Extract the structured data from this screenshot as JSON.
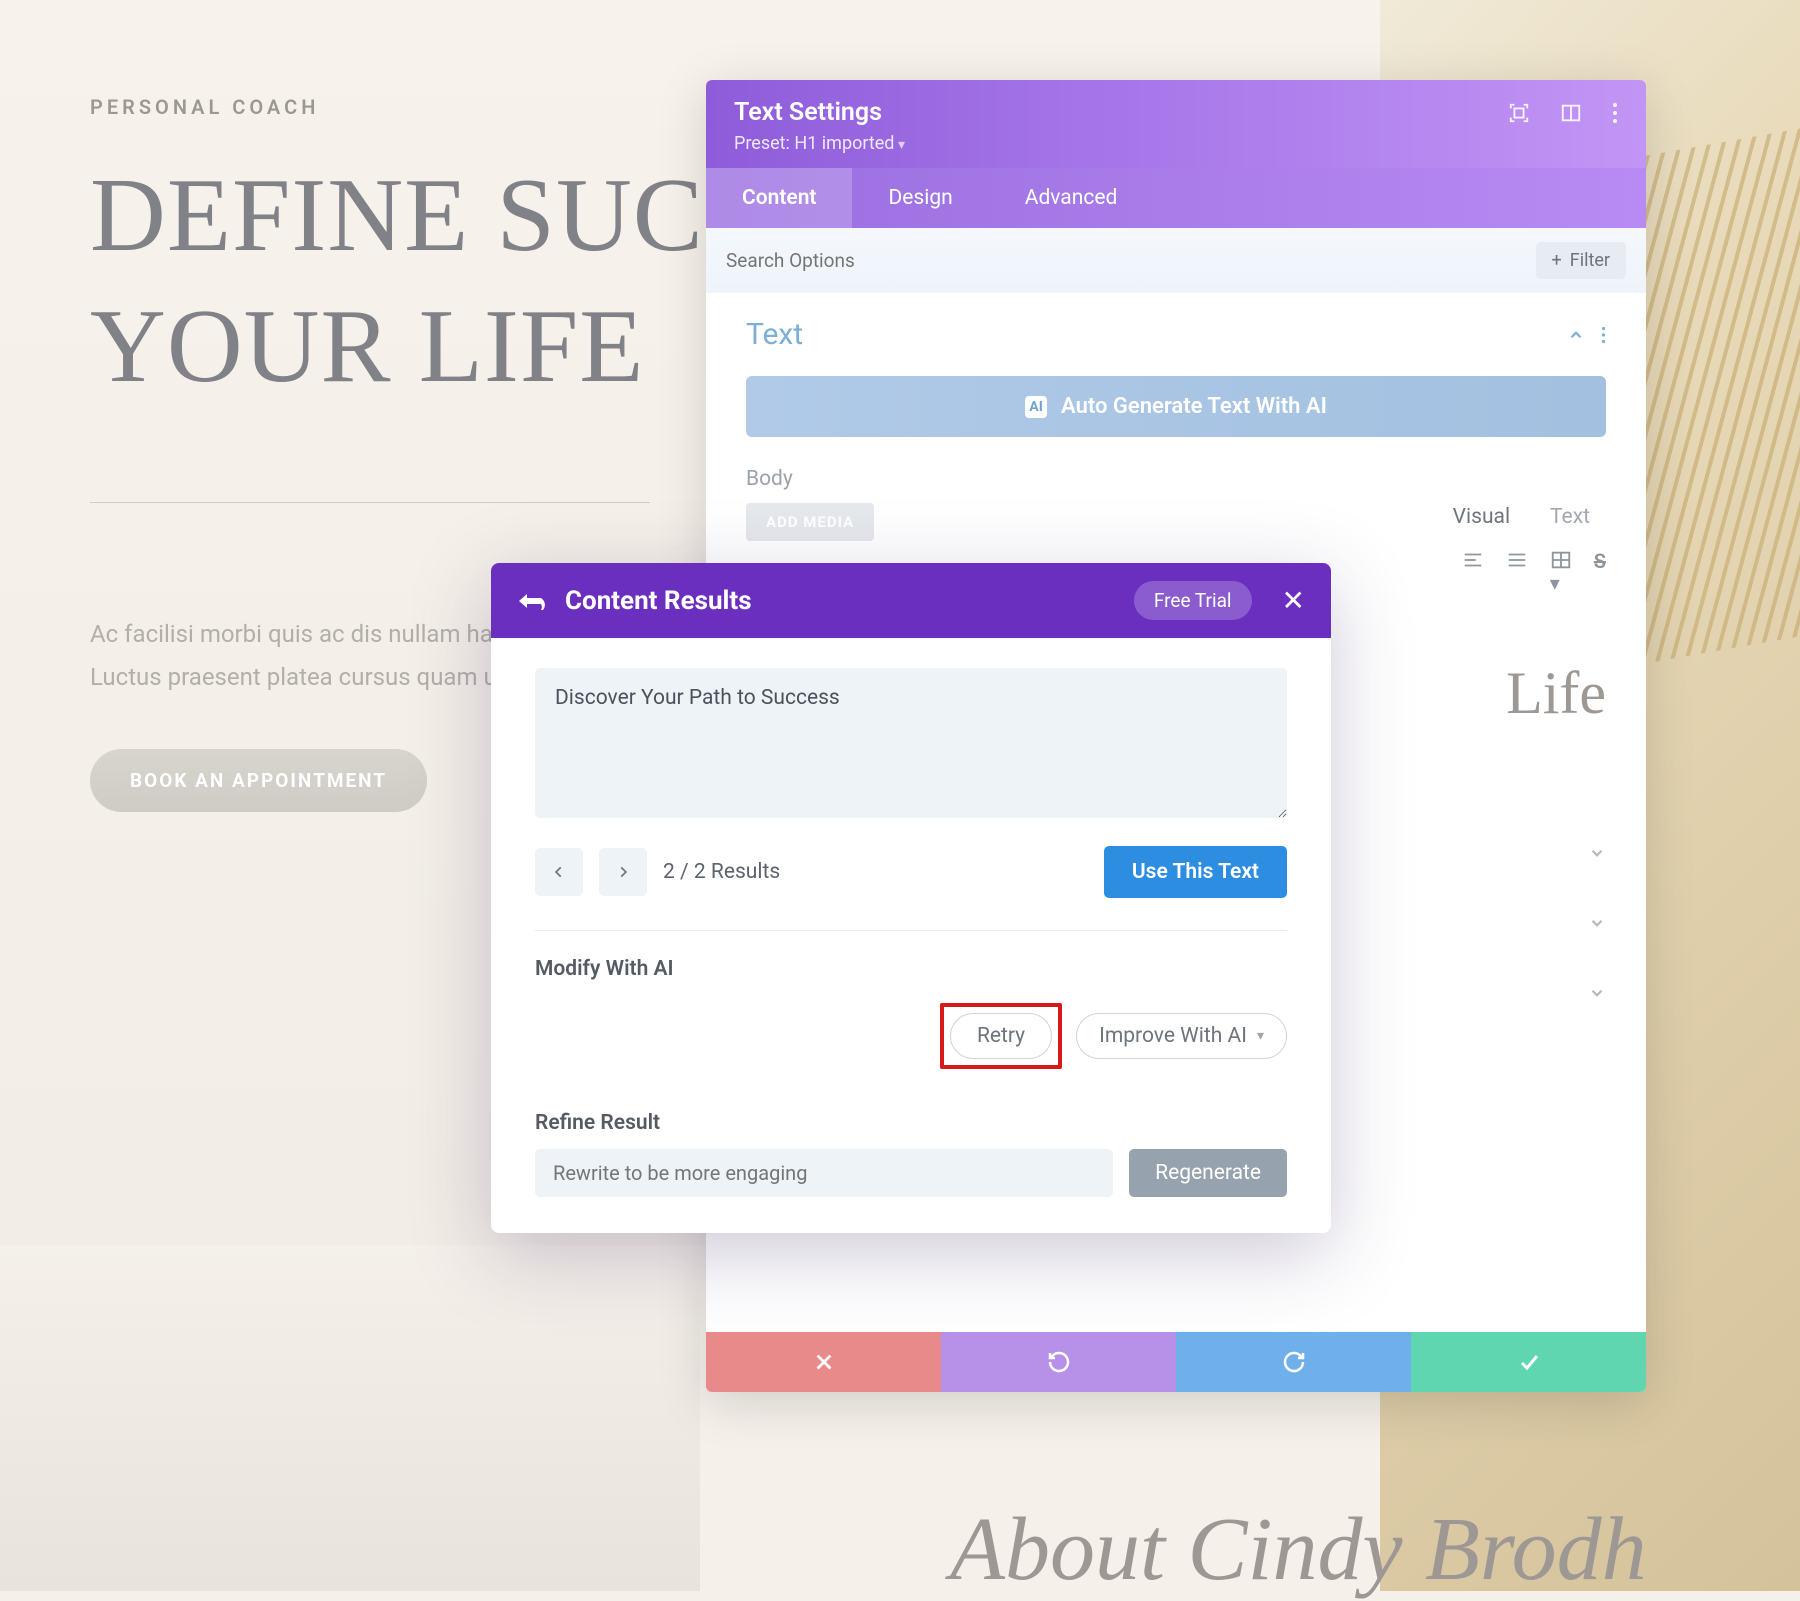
{
  "page": {
    "eyebrow": "PERSONAL COACH",
    "headline": "DEFINE SUCCESS IN YOUR LIFE",
    "lorem": "Ac facilisi morbi quis ac dis nullam hac vestibulum. Luctus praesent platea cursus quam ultricies.",
    "cta": "BOOK AN APPOINTMENT",
    "about_heading": "About Cindy Brodh",
    "editor_preview_tail": "Life"
  },
  "settings": {
    "title": "Text Settings",
    "preset": "Preset: H1 imported",
    "tabs": {
      "content": "Content",
      "design": "Design",
      "advanced": "Advanced"
    },
    "search_placeholder": "Search Options",
    "filter": "Filter",
    "section_text": "Text",
    "ai_button": "Auto Generate Text With AI",
    "body_label": "Body",
    "add_media": "ADD MEDIA",
    "editor_tabs": {
      "visual": "Visual",
      "text": "Text"
    }
  },
  "results": {
    "title": "Content Results",
    "free_trial": "Free Trial",
    "textarea_value": "Discover Your Path to Success",
    "counter": "2 / 2 Results",
    "use_text": "Use This Text",
    "modify_label": "Modify With AI",
    "retry": "Retry",
    "improve": "Improve With AI",
    "refine_label": "Refine Result",
    "refine_placeholder": "Rewrite to be more engaging",
    "regenerate": "Regenerate"
  }
}
